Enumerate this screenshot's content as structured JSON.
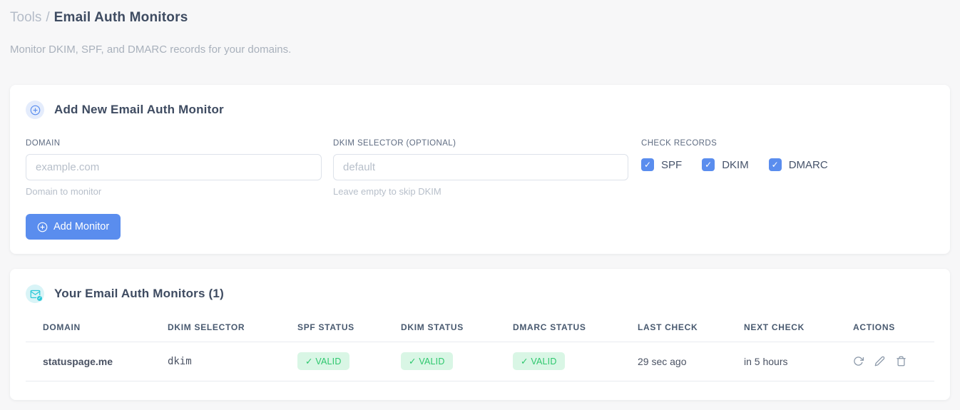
{
  "page": {
    "breadcrumb": {
      "section": "Tools",
      "separator": "/",
      "title": "Email Auth Monitors"
    },
    "subtitle": "Monitor DKIM, SPF, and DMARC records for your domains."
  },
  "add_monitor_card": {
    "title": "Add New Email Auth Monitor",
    "fields": {
      "domain": {
        "label": "DOMAIN",
        "value": "",
        "placeholder": "example.com",
        "hint": "Domain to monitor"
      },
      "dkim_selector": {
        "label": "DKIM SELECTOR (OPTIONAL)",
        "value": "",
        "placeholder": "default",
        "hint": "Leave empty to skip DKIM"
      }
    },
    "check_records": {
      "label": "CHECK RECORDS",
      "options": [
        {
          "label": "SPF",
          "checked": true
        },
        {
          "label": "DKIM",
          "checked": true
        },
        {
          "label": "DMARC",
          "checked": true
        }
      ],
      "check_glyph": "✓"
    },
    "submit_label": "Add Monitor"
  },
  "monitors_card": {
    "title": "Your Email Auth Monitors (1)",
    "count": 1,
    "table": {
      "columns": [
        "DOMAIN",
        "DKIM SELECTOR",
        "SPF STATUS",
        "DKIM STATUS",
        "DMARC STATUS",
        "LAST CHECK",
        "NEXT CHECK",
        "ACTIONS"
      ],
      "rows": [
        {
          "domain": "statuspage.me",
          "dkim_selector": "dkim",
          "spf_status": "✓ VALID",
          "dkim_status": "✓ VALID",
          "dmarc_status": "✓ VALID",
          "last_check": "29 sec ago",
          "next_check": "in 5 hours"
        }
      ]
    }
  },
  "icons": {
    "plus_circle": "circled plus outline",
    "email_check": "envelope with check badge",
    "checkbox_check": "✓",
    "refresh": "circular arrow",
    "edit": "pencil",
    "delete": "trash bin"
  },
  "colors": {
    "accent_blue": "#5a8dee",
    "accent_blue_bg": "#e4ecfc",
    "accent_cyan": "#2bc9d8",
    "accent_cyan_bg": "#d9f4f7",
    "valid_green": "#2dc76d",
    "valid_green_bg": "#d9f6e5",
    "selector_pink": "#e83e8c",
    "page_bg": "#f7f7f8",
    "card_bg": "#ffffff",
    "heading_text": "#3e4b61",
    "muted_text": "#b7bfca"
  }
}
